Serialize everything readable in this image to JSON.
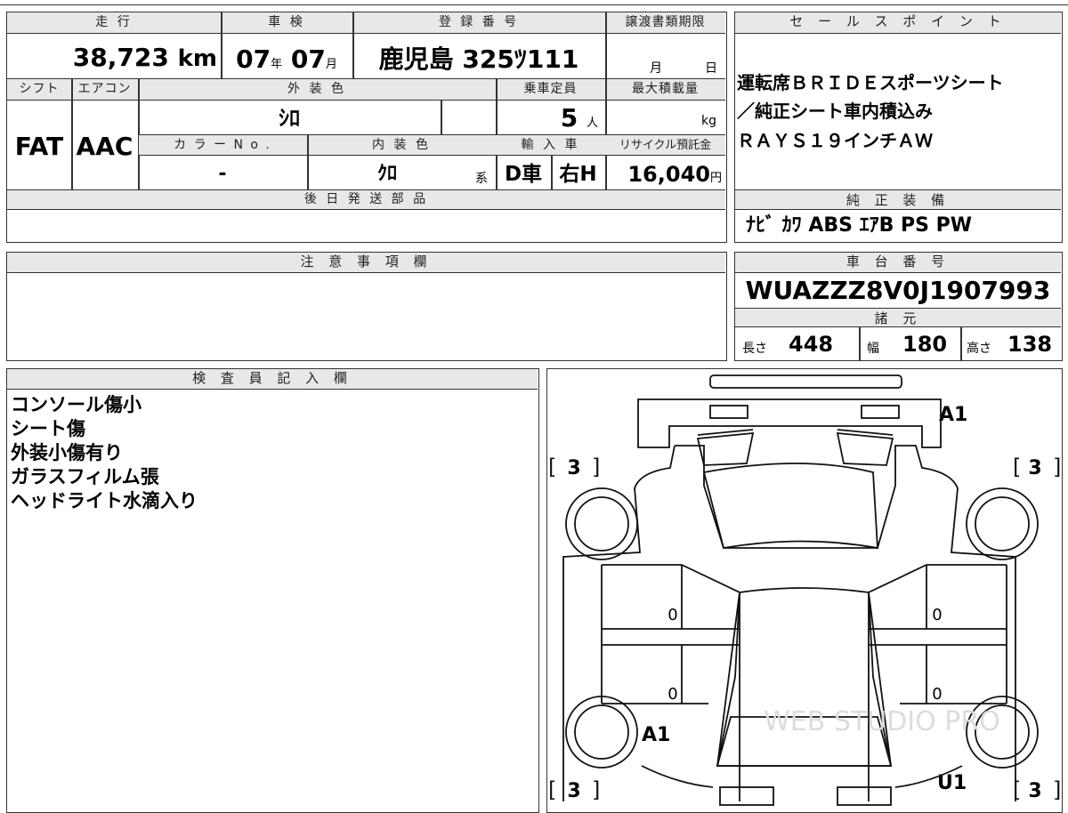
{
  "vehicle": {
    "mileage": {
      "label": "走 行",
      "value": "38,723",
      "unit": "km"
    },
    "inspection": {
      "label": "車 検",
      "year": "07",
      "year_unit": "年",
      "month": "07",
      "month_unit": "月"
    },
    "registration": {
      "label": "登 録 番 号",
      "value": "鹿児島 325ﾂ111"
    },
    "transfer_deadline": {
      "label": "譲渡書類期限",
      "month_unit": "月",
      "day_unit": "日"
    },
    "shift": {
      "label": "シフト",
      "value": "FAT"
    },
    "aircon": {
      "label": "エアコン",
      "value": "AAC"
    },
    "exterior_color": {
      "label": "外 装 色",
      "value": "ｼﾛ"
    },
    "capacity": {
      "label": "乗車定員",
      "value": "5",
      "unit": "人"
    },
    "max_load": {
      "label": "最大積載量",
      "unit": "kg"
    },
    "color_no": {
      "label": "カ ラ ー N o .",
      "value": "-"
    },
    "interior_color": {
      "label": "内 装 色",
      "value": "ｸﾛ",
      "suffix": "系"
    },
    "import": {
      "label": "輸 入 車",
      "drive": "D車",
      "handle": "右H"
    },
    "recycle": {
      "label": "リサイクル預託金",
      "value": "16,040",
      "unit": "円"
    },
    "later_parts": {
      "label": "後 日 発 送 部 品"
    },
    "caution": {
      "label": "注 意 事 項 欄"
    }
  },
  "sales_points": {
    "label": "セ ー ル ス ポ イ ン ト",
    "lines": [
      "運転席ＢＲＩＤＥスポーツシート",
      "／純正シート車内積込み",
      "ＲＡＹＳ１９インチＡＷ"
    ]
  },
  "equipment": {
    "label": "純 正 装 備",
    "value": "ﾅﾋﾞ ｶﾜ ABS ｴｱB PS PW"
  },
  "chassis": {
    "label": "車 台 番 号",
    "value": "WUAZZZ8V0J1907993"
  },
  "specs": {
    "label": "諸 元",
    "length_label": "長さ",
    "length": "448",
    "width_label": "幅",
    "width": "180",
    "height_label": "高さ",
    "height": "138"
  },
  "inspector": {
    "label": "検 査 員 記 入 欄",
    "notes": [
      "コンソール傷小",
      "シート傷",
      "外装小傷有り",
      "ガラスフィルム張",
      "ヘッドライト水滴入り"
    ]
  },
  "diagram": {
    "marks": {
      "front_right": "A1",
      "rear_left": "A1",
      "rear_right": "U1"
    },
    "tires": {
      "front_left": "3",
      "front_right": "3",
      "rear_left": "3",
      "rear_right": "3"
    },
    "doors": {
      "left_front": "0",
      "left_rear": "0",
      "right_front": "0",
      "right_rear": "0"
    },
    "watermark": "WEB STUDIO PRO"
  }
}
